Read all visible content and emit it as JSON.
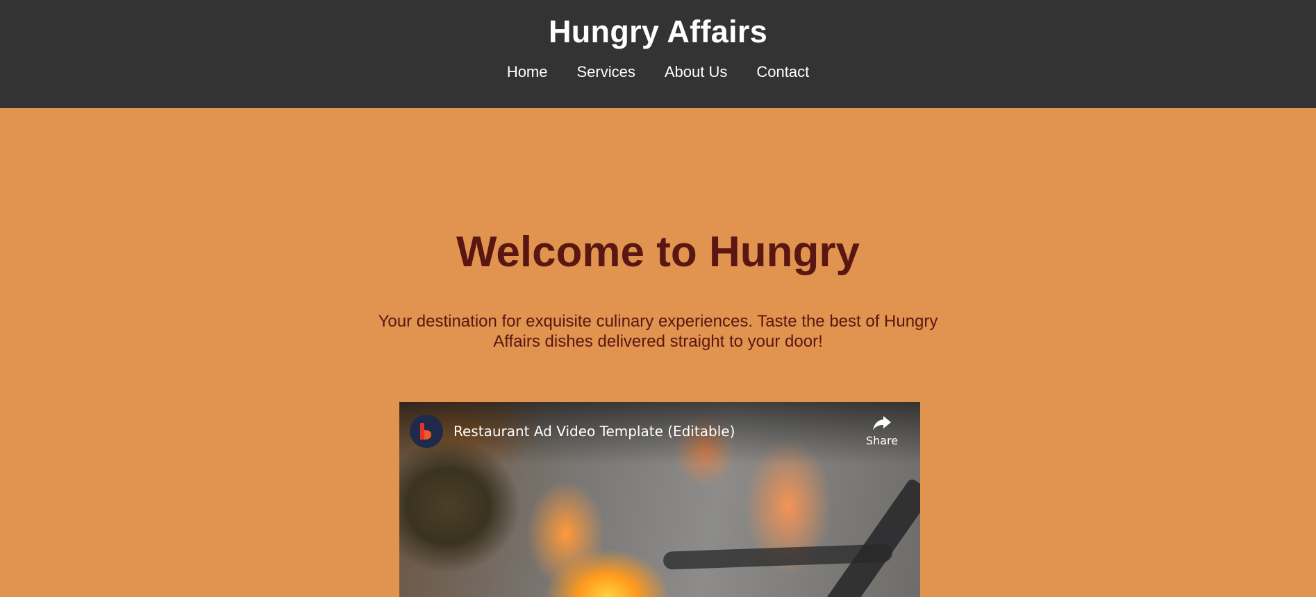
{
  "header": {
    "site_title": "Hungry Affairs",
    "nav": [
      {
        "label": "Home"
      },
      {
        "label": "Services"
      },
      {
        "label": "About Us"
      },
      {
        "label": "Contact"
      }
    ]
  },
  "hero": {
    "title": "Welcome to Hungry",
    "subtitle": "Your destination for exquisite culinary experiences. Taste the best of Hungry Affairs dishes delivered straight to your door!"
  },
  "video": {
    "title": "Restaurant Ad Video Template (Editable)",
    "share_label": "Share",
    "channel_icon": "channel-logo-icon",
    "share_icon": "share-arrow-icon"
  },
  "colors": {
    "header_bg": "#333333",
    "page_bg": "#e0944f",
    "heading_text": "#5a1612",
    "nav_text": "#ffffff"
  }
}
